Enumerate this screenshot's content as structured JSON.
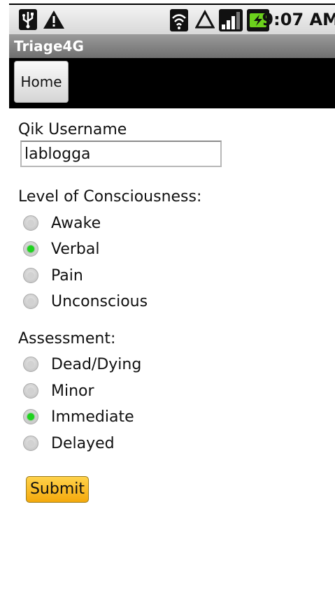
{
  "status_bar": {
    "time": "9:07 AM",
    "icons": [
      "usb-icon",
      "warning-icon",
      "wifi-icon",
      "signal-triangle-icon",
      "cell-signal-icon",
      "battery-charging-icon"
    ]
  },
  "app": {
    "title": "Triage4G"
  },
  "nav": {
    "home_label": "Home"
  },
  "form": {
    "username_label": "Qik Username",
    "username_value": "lablogga",
    "consciousness_label": "Level of Consciousness:",
    "consciousness_options": [
      {
        "label": "Awake",
        "checked": false
      },
      {
        "label": "Verbal",
        "checked": true
      },
      {
        "label": "Pain",
        "checked": false
      },
      {
        "label": "Unconscious",
        "checked": false
      }
    ],
    "assessment_label": "Assessment:",
    "assessment_options": [
      {
        "label": "Dead/Dying",
        "checked": false
      },
      {
        "label": "Minor",
        "checked": false
      },
      {
        "label": "Immediate",
        "checked": true
      },
      {
        "label": "Delayed",
        "checked": false
      }
    ],
    "submit_label": "Submit"
  },
  "colors": {
    "radio_checked": "#1fd31f",
    "submit_button": "#f4a90c",
    "nav_background": "#000000"
  }
}
